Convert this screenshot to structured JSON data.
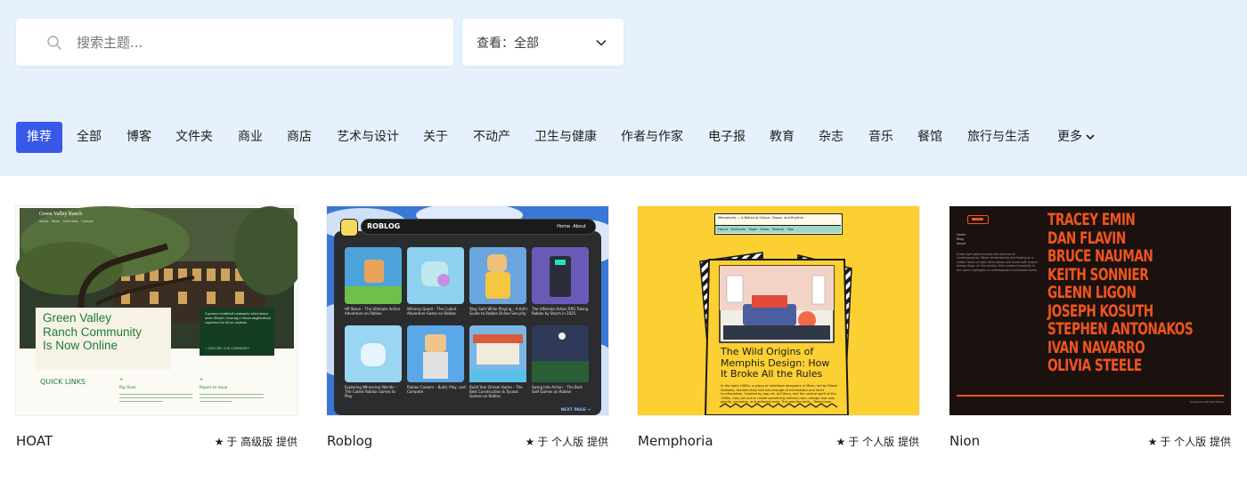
{
  "search": {
    "placeholder": "搜索主题..."
  },
  "filter": {
    "label": "查看：全部"
  },
  "categories": {
    "active": "推荐",
    "items": [
      "全部",
      "博客",
      "文件夹",
      "商业",
      "商店",
      "艺术与设计",
      "关于",
      "不动产",
      "卫生与健康",
      "作者与作家",
      "电子报",
      "教育",
      "杂志",
      "音乐",
      "餐馆",
      "旅行与生活"
    ],
    "more": "更多"
  },
  "themes": [
    {
      "name": "HOAT",
      "meta": "于 高级版 提供",
      "thumb": {
        "brand": "Green Valley Ranch",
        "nav": [
          "About",
          "News",
          "Amenities",
          "Contact"
        ],
        "headline": [
          "Green Valley",
          "Ranch Community",
          "Is Now Online"
        ],
        "blurb": "A premier residential community where luxury meets lifestyle, fostering a vibrant neighborhood experience for all our residents.",
        "cta": "→ EXPLORE OUR COMMUNITY",
        "quick": "QUICK LINKS",
        "col1_title": "Pay Dues",
        "col2_title": "Report an Issue"
      }
    },
    {
      "name": "Roblog",
      "meta": "于 个人版 提供",
      "thumb": {
        "brand": "ROBLOG",
        "nav": [
          "Home",
          "About"
        ],
        "posts": [
          "HP Steve – The Ultimate Action Adventure on Roblox",
          "Whimsy Quest – The Cutest Adventure Game on Roblox",
          "Stay Safe While Playing – A Kid's Guide to Roblox Online Security",
          "The Ultimate Action RPG Taking Roblox by Storm in 2025",
          "Exploring Whimsical Worlds – The Cutest Roblox Games to Play",
          "Roblox Careers – Build, Play, and Compete",
          "Build Your Dream Home – The Best Construction & Tycoon Games on Roblox",
          "Swing Into Action – The Best Golf Games on Roblox"
        ],
        "next": "NEXT PAGE →"
      }
    },
    {
      "name": "Memphoria",
      "meta": "于 个人版 提供",
      "thumb": {
        "brand": "Memphoria — A Ballad of Colour, Shape, and Rhythm",
        "nav": [
          "Home",
          "Archives",
          "Page",
          "Posts",
          "Search",
          "Ups"
        ],
        "headline": "The Wild Origins of Memphis Design: How It Broke All the Rules",
        "excerpt": "In the early 1980s, a group of rebellious designers in Milan, led by Ettore Sottsass, decided they had had enough of minimalism and strict functionalism. Inspired by pop art, Art Deco, and the radical spirit of the 1960s, they set out to create something entirely new—design that was playful, eccentric, and defiantly bold. This was the birth... Read more"
      }
    },
    {
      "name": "Nion",
      "meta": "于 个人版 提供",
      "thumb": {
        "names": [
          "TRACEY EMIN",
          "DAN FLAVIN",
          "BRUCE NAUMAN",
          "KEITH SONNIER",
          "GLENN LIGON",
          "JOSEPH KOSUTH",
          "STEPHEN ANTONAKOS",
          "IVAN NAVARRO",
          "OLIVIA STEELE"
        ],
        "nav": [
          "Home",
          "Blog",
          "About"
        ],
        "blurb": "Guide light gates through the absence of contemporaries. When remembering and flowing on a hidden forms of light, alive pieces and found with origins energy flows, at this section. Also creates tranquility in the rooms highlights of contemporary illuminated works.",
        "footer": "Designed with WordPress"
      }
    }
  ],
  "colors": {
    "accent": "#3858e9",
    "hero_bg": "#e6f1fd",
    "roblog_bg": "#2b2c2e",
    "memphis_yellow": "#fccf33",
    "nion_orange": "#f0541e"
  }
}
